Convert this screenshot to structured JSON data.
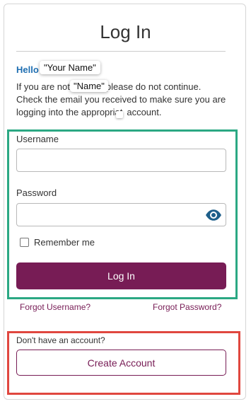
{
  "header": {
    "title": "Log In"
  },
  "greeting": {
    "hello": "Hello",
    "your_name_tag": "\"Your Name\"",
    "name_tag": "\"Name\"",
    "line1_before": "If you are not",
    "line1_after": "please do not continue.",
    "line2": "Check the email you received to make sure you are",
    "line3_before": "logging into the appropriat",
    "line3_after": "account."
  },
  "form": {
    "username_label": "Username",
    "username_value": "",
    "password_label": "Password",
    "password_value": "",
    "show_password_icon": "eye-icon",
    "remember_label": "Remember me",
    "remember_checked": false,
    "login_button": "Log In"
  },
  "links": {
    "forgot_username": "Forgot Username?",
    "forgot_password": "Forgot Password?"
  },
  "signup": {
    "prompt": "Don't have an account?",
    "create_button": "Create Account"
  },
  "colors": {
    "brand": "#771c55",
    "hello": "#1f6fb2",
    "highlight_login_section": "#2ba883",
    "highlight_signup_section": "#e0473f"
  }
}
